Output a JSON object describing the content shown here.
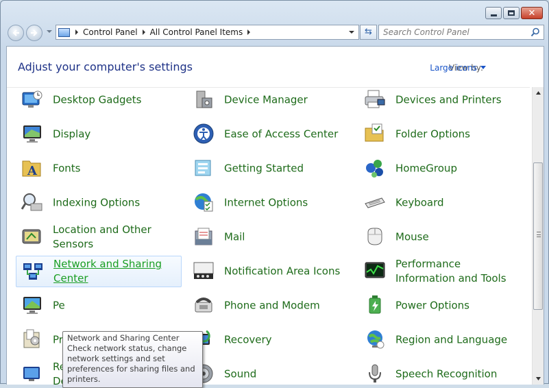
{
  "window": {
    "buttons": {
      "minimize": "minimize",
      "maximize": "maximize",
      "close": "✕"
    }
  },
  "address": {
    "crumbs": [
      "Control Panel",
      "All Control Panel Items"
    ]
  },
  "search": {
    "placeholder": "Search Control Panel"
  },
  "header": {
    "title": "Adjust your computer's settings",
    "view_by_label": "View by:",
    "view_by_value": "Large icons"
  },
  "items": [
    {
      "label": "Desktop Gadgets",
      "icon": "desktop-gadgets-icon"
    },
    {
      "label": "Device Manager",
      "icon": "device-manager-icon"
    },
    {
      "label": "Devices and Printers",
      "icon": "printer-icon"
    },
    {
      "label": "Display",
      "icon": "display-icon"
    },
    {
      "label": "Ease of Access Center",
      "icon": "ease-of-access-icon"
    },
    {
      "label": "Folder Options",
      "icon": "folder-options-icon"
    },
    {
      "label": "Fonts",
      "icon": "fonts-icon"
    },
    {
      "label": "Getting Started",
      "icon": "getting-started-icon"
    },
    {
      "label": "HomeGroup",
      "icon": "homegroup-icon"
    },
    {
      "label": "Indexing Options",
      "icon": "indexing-icon"
    },
    {
      "label": "Internet Options",
      "icon": "internet-options-icon"
    },
    {
      "label": "Keyboard",
      "icon": "keyboard-icon"
    },
    {
      "label": "Location and Other Sensors",
      "icon": "sensors-icon"
    },
    {
      "label": "Mail",
      "icon": "mail-icon"
    },
    {
      "label": "Mouse",
      "icon": "mouse-icon"
    },
    {
      "label": "Network and Sharing Center",
      "icon": "network-icon"
    },
    {
      "label": "Notification Area Icons",
      "icon": "notification-icon"
    },
    {
      "label": "Performance Information and Tools",
      "icon": "performance-icon"
    },
    {
      "label": "Pe",
      "icon": "personalization-icon"
    },
    {
      "label": "Phone and Modem",
      "icon": "phone-modem-icon"
    },
    {
      "label": "Power Options",
      "icon": "power-icon"
    },
    {
      "label": "Programs and Features",
      "icon": "programs-icon"
    },
    {
      "label": "Recovery",
      "icon": "recovery-icon"
    },
    {
      "label": "Region and Language",
      "icon": "region-icon"
    },
    {
      "label": "RemoteApp and Desktop Connections",
      "icon": "remoteapp-icon"
    },
    {
      "label": "Sound",
      "icon": "sound-icon"
    },
    {
      "label": "Speech Recognition",
      "icon": "speech-icon"
    }
  ],
  "tooltip": {
    "title": "Network and Sharing Center",
    "body": "Check network status, change network settings and set preferences for sharing files and printers."
  },
  "colors": {
    "link_green": "#1e6b1a",
    "heading_blue": "#1e3287",
    "view_link_blue": "#1a55c8"
  }
}
